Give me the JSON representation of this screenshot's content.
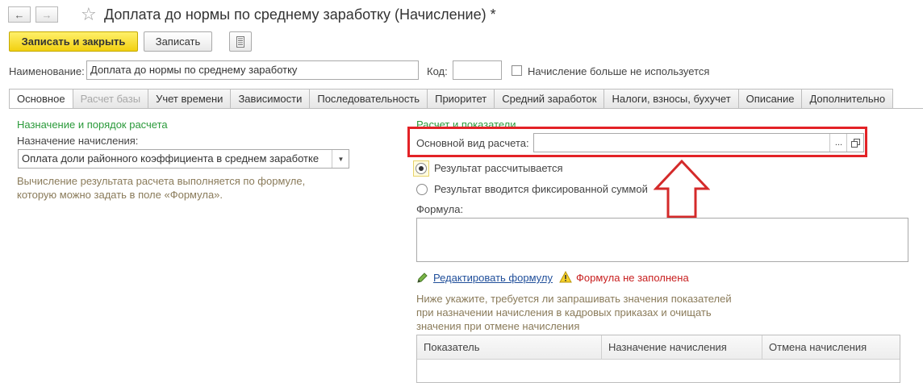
{
  "window": {
    "back_icon": "←",
    "forward_icon": "→",
    "title": "Доплата до нормы по среднему заработку (Начисление) *"
  },
  "toolbar": {
    "save_close": "Записать и закрыть",
    "save": "Записать"
  },
  "header": {
    "name_label": "Наименование:",
    "name_value": "Доплата до нормы по среднему заработку",
    "code_label": "Код:",
    "code_value": "",
    "unused_label": "Начисление больше не используется"
  },
  "tabs": [
    {
      "label": "Основное"
    },
    {
      "label": "Расчет базы"
    },
    {
      "label": "Учет времени"
    },
    {
      "label": "Зависимости"
    },
    {
      "label": "Последовательность"
    },
    {
      "label": "Приоритет"
    },
    {
      "label": "Средний заработок"
    },
    {
      "label": "Налоги, взносы, бухучет"
    },
    {
      "label": "Описание"
    },
    {
      "label": "Дополнительно"
    }
  ],
  "left": {
    "section_title": "Назначение и порядок расчета",
    "purpose_label": "Назначение начисления:",
    "purpose_value": "Оплата доли районного коэффициента в среднем заработке",
    "hint_line1": "Вычисление результата расчета выполняется по формуле,",
    "hint_line2": "которую можно задать в поле «Формула»."
  },
  "right": {
    "section_title": "Расчет и показатели",
    "base_label": "Основной вид расчета:",
    "base_value": "",
    "dots": "...",
    "radio_calc": "Результат рассчитывается",
    "radio_fixed": "Результат вводится фиксированной суммой",
    "formula_label": "Формула:",
    "edit_formula": "Редактировать формулу",
    "formula_error": "Формула не заполнена",
    "indicators_hint1": "Ниже укажите, требуется ли запрашивать значения показателей",
    "indicators_hint2": "при назначении начисления в кадровых приказах и очищать",
    "indicators_hint3": "значения при отмене начисления",
    "table_headers": [
      "Показатель",
      "Назначение начисления",
      "Отмена начисления"
    ]
  },
  "colors": {
    "highlight": "#e32226",
    "section": "#2a9a3a",
    "primary_button": "#f2d011"
  }
}
